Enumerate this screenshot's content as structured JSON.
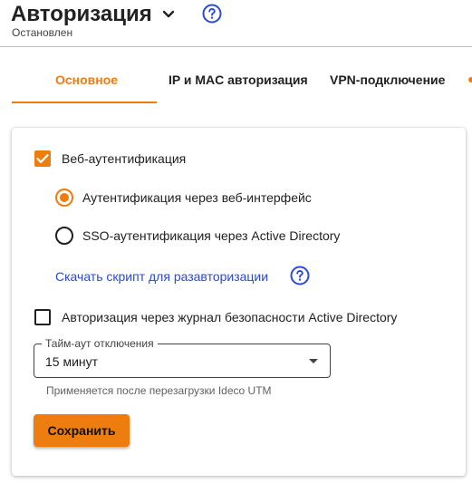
{
  "header": {
    "title": "Авторизация",
    "status": "Остановлен",
    "icons": [
      "chevron-down-icon",
      "help-icon"
    ]
  },
  "tabs": [
    {
      "label": "Основное",
      "active": true
    },
    {
      "label": "IP и MAC авторизация",
      "active": false
    },
    {
      "label": "VPN-подключение",
      "active": false
    }
  ],
  "settings": {
    "web_auth": {
      "label": "Веб-аутентификация",
      "checked": true
    },
    "auth_methods": [
      {
        "label": "Аутентификация через веб-интерфейс",
        "selected": true
      },
      {
        "label": "SSO-аутентификация через Active Directory",
        "selected": false
      }
    ],
    "download_link": "Скачать скрипт для разавторизации",
    "ad_journal": {
      "label": "Авторизация через журнал безопасности Active Directory",
      "checked": false
    },
    "timeout": {
      "label": "Тайм-аут отключения",
      "value": "15 минут",
      "helper": "Применяется после перезагрузки Ideco UTM"
    },
    "save_label": "Сохранить"
  },
  "colors": {
    "accent": "#ed7d0f",
    "link": "#2b4ad6",
    "help_icon": "#2b4ad6"
  }
}
